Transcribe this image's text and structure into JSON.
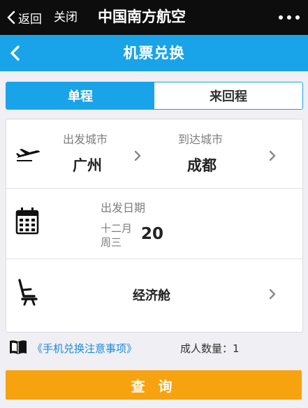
{
  "topbar": {
    "back_label": "返回",
    "close_label": "关闭",
    "title": "中国南方航空"
  },
  "header": {
    "title": "机票兑换"
  },
  "tabs": [
    {
      "label": "单程",
      "active": true
    },
    {
      "label": "来回程",
      "active": false
    }
  ],
  "route": {
    "departure_label": "出发城市",
    "departure_city": "广州",
    "arrival_label": "到达城市",
    "arrival_city": "成都"
  },
  "date": {
    "label": "出发日期",
    "month": "十二月",
    "weekday": "周三",
    "day": "20"
  },
  "cabin": {
    "value": "经济舱"
  },
  "footer": {
    "notice_link": "《手机兑换注意事项》",
    "passenger_label": "成人数量：",
    "passenger_count": "1"
  },
  "query_button": "查 询",
  "colors": {
    "topbar": "#0d0d0d",
    "brand_blue": "#19a3e9",
    "query_orange": "#f7a20f",
    "link_blue": "#1a8ad8"
  },
  "icons": [
    "back-chevron-icon",
    "more-dots-icon",
    "airplane-icon",
    "calendar-icon",
    "seat-icon",
    "book-icon",
    "chevron-right-icon"
  ]
}
